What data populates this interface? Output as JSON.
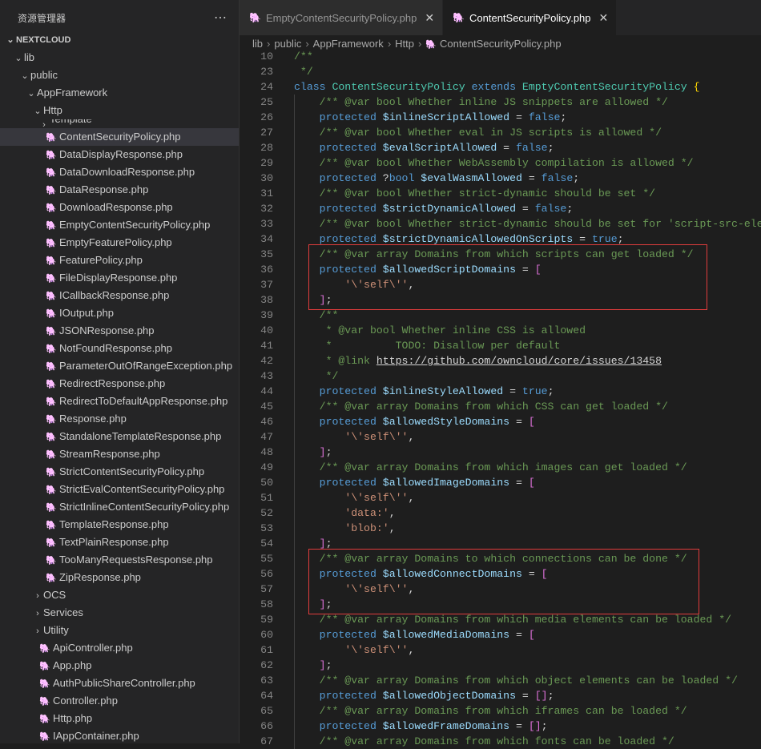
{
  "sidebar": {
    "title": "资源管理器",
    "more_icon": "ellipsis-icon",
    "root": "NEXTCLOUD",
    "tree": [
      {
        "label": "lib",
        "type": "folder",
        "open": true,
        "level": 1
      },
      {
        "label": "public",
        "type": "folder",
        "open": true,
        "level": 2
      },
      {
        "label": "AppFramework",
        "type": "folder",
        "open": true,
        "level": 3
      },
      {
        "label": "Http",
        "type": "folder",
        "open": true,
        "level": 4
      },
      {
        "label": "Template",
        "type": "folder",
        "open": false,
        "level": 5
      },
      {
        "label": "ContentSecurityPolicy.php",
        "type": "php",
        "level": 5,
        "selected": true
      },
      {
        "label": "DataDisplayResponse.php",
        "type": "php",
        "level": 5
      },
      {
        "label": "DataDownloadResponse.php",
        "type": "php",
        "level": 5
      },
      {
        "label": "DataResponse.php",
        "type": "php",
        "level": 5
      },
      {
        "label": "DownloadResponse.php",
        "type": "php",
        "level": 5
      },
      {
        "label": "EmptyContentSecurityPolicy.php",
        "type": "php",
        "level": 5
      },
      {
        "label": "EmptyFeaturePolicy.php",
        "type": "php",
        "level": 5
      },
      {
        "label": "FeaturePolicy.php",
        "type": "php",
        "level": 5
      },
      {
        "label": "FileDisplayResponse.php",
        "type": "php",
        "level": 5
      },
      {
        "label": "ICallbackResponse.php",
        "type": "php",
        "level": 5
      },
      {
        "label": "IOutput.php",
        "type": "php",
        "level": 5
      },
      {
        "label": "JSONResponse.php",
        "type": "php",
        "level": 5
      },
      {
        "label": "NotFoundResponse.php",
        "type": "php",
        "level": 5
      },
      {
        "label": "ParameterOutOfRangeException.php",
        "type": "php",
        "level": 5
      },
      {
        "label": "RedirectResponse.php",
        "type": "php",
        "level": 5
      },
      {
        "label": "RedirectToDefaultAppResponse.php",
        "type": "php",
        "level": 5
      },
      {
        "label": "Response.php",
        "type": "php",
        "level": 5
      },
      {
        "label": "StandaloneTemplateResponse.php",
        "type": "php",
        "level": 5
      },
      {
        "label": "StreamResponse.php",
        "type": "php",
        "level": 5
      },
      {
        "label": "StrictContentSecurityPolicy.php",
        "type": "php",
        "level": 5
      },
      {
        "label": "StrictEvalContentSecurityPolicy.php",
        "type": "php",
        "level": 5
      },
      {
        "label": "StrictInlineContentSecurityPolicy.php",
        "type": "php",
        "level": 5
      },
      {
        "label": "TemplateResponse.php",
        "type": "php",
        "level": 5
      },
      {
        "label": "TextPlainResponse.php",
        "type": "php",
        "level": 5
      },
      {
        "label": "TooManyRequestsResponse.php",
        "type": "php",
        "level": 5
      },
      {
        "label": "ZipResponse.php",
        "type": "php",
        "level": 5
      },
      {
        "label": "OCS",
        "type": "folder",
        "open": false,
        "level": 4
      },
      {
        "label": "Services",
        "type": "folder",
        "open": false,
        "level": 4
      },
      {
        "label": "Utility",
        "type": "folder",
        "open": false,
        "level": 4
      },
      {
        "label": "ApiController.php",
        "type": "php",
        "level": 4
      },
      {
        "label": "App.php",
        "type": "php",
        "level": 4
      },
      {
        "label": "AuthPublicShareController.php",
        "type": "php",
        "level": 4
      },
      {
        "label": "Controller.php",
        "type": "php",
        "level": 4
      },
      {
        "label": "Http.php",
        "type": "php",
        "level": 4
      },
      {
        "label": "IAppContainer.php",
        "type": "php",
        "level": 4
      }
    ]
  },
  "tabs": [
    {
      "label": "EmptyContentSecurityPolicy.php",
      "active": false,
      "icon": "php-elephant-icon"
    },
    {
      "label": "ContentSecurityPolicy.php",
      "active": true,
      "icon": "php-elephant-icon"
    }
  ],
  "breadcrumb": [
    "lib",
    "public",
    "AppFramework",
    "Http",
    "ContentSecurityPolicy.php"
  ],
  "colors": {
    "comment": "#6a9955",
    "keyword": "#569cd6",
    "variable": "#9cdcfe",
    "class": "#4ec9b0",
    "string": "#ce9178",
    "bracket": "#da70d6",
    "brace": "#ffd700",
    "highlight_box": "#e03c3c",
    "php_icon": "#a074c4"
  },
  "code": [
    {
      "n": "10",
      "t": [
        [
          "c",
          "/**"
        ]
      ]
    },
    {
      "n": "23",
      "t": [
        [
          "c",
          " */"
        ]
      ]
    },
    {
      "n": "24",
      "t": [
        [
          "k",
          "class "
        ],
        [
          "cl",
          "ContentSecurityPolicy "
        ],
        [
          "k",
          "extends "
        ],
        [
          "cl",
          "EmptyContentSecurityPolicy "
        ],
        [
          "b2",
          "{"
        ]
      ]
    },
    {
      "n": "25",
      "t": [
        [
          "p",
          "    "
        ],
        [
          "c",
          "/** @var bool Whether inline JS snippets are allowed */"
        ]
      ]
    },
    {
      "n": "26",
      "t": [
        [
          "p",
          "    "
        ],
        [
          "k",
          "protected "
        ],
        [
          "v",
          "$inlineScriptAllowed"
        ],
        [
          "p",
          " = "
        ],
        [
          "k",
          "false"
        ],
        [
          "p",
          ";"
        ]
      ]
    },
    {
      "n": "27",
      "t": [
        [
          "p",
          "    "
        ],
        [
          "c",
          "/** @var bool Whether eval in JS scripts is allowed */"
        ]
      ]
    },
    {
      "n": "28",
      "t": [
        [
          "p",
          "    "
        ],
        [
          "k",
          "protected "
        ],
        [
          "v",
          "$evalScriptAllowed"
        ],
        [
          "p",
          " = "
        ],
        [
          "k",
          "false"
        ],
        [
          "p",
          ";"
        ]
      ]
    },
    {
      "n": "29",
      "t": [
        [
          "p",
          "    "
        ],
        [
          "c",
          "/** @var bool Whether WebAssembly compilation is allowed */"
        ]
      ]
    },
    {
      "n": "30",
      "t": [
        [
          "p",
          "    "
        ],
        [
          "k",
          "protected "
        ],
        [
          "p",
          "?"
        ],
        [
          "k",
          "bool "
        ],
        [
          "v",
          "$evalWasmAllowed"
        ],
        [
          "p",
          " = "
        ],
        [
          "k",
          "false"
        ],
        [
          "p",
          ";"
        ]
      ]
    },
    {
      "n": "31",
      "t": [
        [
          "p",
          "    "
        ],
        [
          "c",
          "/** @var bool Whether strict-dynamic should be set */"
        ]
      ]
    },
    {
      "n": "32",
      "t": [
        [
          "p",
          "    "
        ],
        [
          "k",
          "protected "
        ],
        [
          "v",
          "$strictDynamicAllowed"
        ],
        [
          "p",
          " = "
        ],
        [
          "k",
          "false"
        ],
        [
          "p",
          ";"
        ]
      ]
    },
    {
      "n": "33",
      "t": [
        [
          "p",
          "    "
        ],
        [
          "c",
          "/** @var bool Whether strict-dynamic should be set for 'script-src-elem'"
        ]
      ]
    },
    {
      "n": "34",
      "t": [
        [
          "p",
          "    "
        ],
        [
          "k",
          "protected "
        ],
        [
          "v",
          "$strictDynamicAllowedOnScripts"
        ],
        [
          "p",
          " = "
        ],
        [
          "k",
          "true"
        ],
        [
          "p",
          ";"
        ]
      ]
    },
    {
      "n": "35",
      "t": [
        [
          "p",
          "    "
        ],
        [
          "c",
          "/** @var array Domains from which scripts can get loaded */"
        ]
      ]
    },
    {
      "n": "36",
      "t": [
        [
          "p",
          "    "
        ],
        [
          "k",
          "protected "
        ],
        [
          "v",
          "$allowedScriptDomains"
        ],
        [
          "p",
          " = "
        ],
        [
          "b",
          "["
        ]
      ]
    },
    {
      "n": "37",
      "t": [
        [
          "p",
          "        "
        ],
        [
          "s",
          "'\\'self\\''"
        ],
        [
          "p",
          ","
        ]
      ]
    },
    {
      "n": "38",
      "t": [
        [
          "p",
          "    "
        ],
        [
          "b",
          "]"
        ],
        [
          "p",
          ";"
        ]
      ]
    },
    {
      "n": "39",
      "t": [
        [
          "p",
          "    "
        ],
        [
          "c",
          "/**"
        ]
      ]
    },
    {
      "n": "40",
      "t": [
        [
          "p",
          "    "
        ],
        [
          "c",
          " * @var bool Whether inline CSS is allowed"
        ]
      ]
    },
    {
      "n": "41",
      "t": [
        [
          "p",
          "    "
        ],
        [
          "c",
          " *          TODO: Disallow per default"
        ]
      ]
    },
    {
      "n": "42",
      "t": [
        [
          "p",
          "    "
        ],
        [
          "c",
          " * @link "
        ],
        [
          "l",
          "https://github.com/owncloud/core/issues/13458"
        ]
      ]
    },
    {
      "n": "43",
      "t": [
        [
          "p",
          "    "
        ],
        [
          "c",
          " */"
        ]
      ]
    },
    {
      "n": "44",
      "t": [
        [
          "p",
          "    "
        ],
        [
          "k",
          "protected "
        ],
        [
          "v",
          "$inlineStyleAllowed"
        ],
        [
          "p",
          " = "
        ],
        [
          "k",
          "true"
        ],
        [
          "p",
          ";"
        ]
      ]
    },
    {
      "n": "45",
      "t": [
        [
          "p",
          "    "
        ],
        [
          "c",
          "/** @var array Domains from which CSS can get loaded */"
        ]
      ]
    },
    {
      "n": "46",
      "t": [
        [
          "p",
          "    "
        ],
        [
          "k",
          "protected "
        ],
        [
          "v",
          "$allowedStyleDomains"
        ],
        [
          "p",
          " = "
        ],
        [
          "b",
          "["
        ]
      ]
    },
    {
      "n": "47",
      "t": [
        [
          "p",
          "        "
        ],
        [
          "s",
          "'\\'self\\''"
        ],
        [
          "p",
          ","
        ]
      ]
    },
    {
      "n": "48",
      "t": [
        [
          "p",
          "    "
        ],
        [
          "b",
          "]"
        ],
        [
          "p",
          ";"
        ]
      ]
    },
    {
      "n": "49",
      "t": [
        [
          "p",
          "    "
        ],
        [
          "c",
          "/** @var array Domains from which images can get loaded */"
        ]
      ]
    },
    {
      "n": "50",
      "t": [
        [
          "p",
          "    "
        ],
        [
          "k",
          "protected "
        ],
        [
          "v",
          "$allowedImageDomains"
        ],
        [
          "p",
          " = "
        ],
        [
          "b",
          "["
        ]
      ]
    },
    {
      "n": "51",
      "t": [
        [
          "p",
          "        "
        ],
        [
          "s",
          "'\\'self\\''"
        ],
        [
          "p",
          ","
        ]
      ]
    },
    {
      "n": "52",
      "t": [
        [
          "p",
          "        "
        ],
        [
          "s",
          "'data:'"
        ],
        [
          "p",
          ","
        ]
      ]
    },
    {
      "n": "53",
      "t": [
        [
          "p",
          "        "
        ],
        [
          "s",
          "'blob:'"
        ],
        [
          "p",
          ","
        ]
      ]
    },
    {
      "n": "54",
      "t": [
        [
          "p",
          "    "
        ],
        [
          "b",
          "]"
        ],
        [
          "p",
          ";"
        ]
      ]
    },
    {
      "n": "55",
      "t": [
        [
          "p",
          "    "
        ],
        [
          "c",
          "/** @var array Domains to which connections can be done */"
        ]
      ]
    },
    {
      "n": "56",
      "t": [
        [
          "p",
          "    "
        ],
        [
          "k",
          "protected "
        ],
        [
          "v",
          "$allowedConnectDomains"
        ],
        [
          "p",
          " = "
        ],
        [
          "b",
          "["
        ]
      ]
    },
    {
      "n": "57",
      "t": [
        [
          "p",
          "        "
        ],
        [
          "s",
          "'\\'self\\''"
        ],
        [
          "p",
          ","
        ]
      ]
    },
    {
      "n": "58",
      "t": [
        [
          "p",
          "    "
        ],
        [
          "b",
          "]"
        ],
        [
          "p",
          ";"
        ]
      ]
    },
    {
      "n": "59",
      "t": [
        [
          "p",
          "    "
        ],
        [
          "c",
          "/** @var array Domains from which media elements can be loaded */"
        ]
      ]
    },
    {
      "n": "60",
      "t": [
        [
          "p",
          "    "
        ],
        [
          "k",
          "protected "
        ],
        [
          "v",
          "$allowedMediaDomains"
        ],
        [
          "p",
          " = "
        ],
        [
          "b",
          "["
        ]
      ]
    },
    {
      "n": "61",
      "t": [
        [
          "p",
          "        "
        ],
        [
          "s",
          "'\\'self\\''"
        ],
        [
          "p",
          ","
        ]
      ]
    },
    {
      "n": "62",
      "t": [
        [
          "p",
          "    "
        ],
        [
          "b",
          "]"
        ],
        [
          "p",
          ";"
        ]
      ]
    },
    {
      "n": "63",
      "t": [
        [
          "p",
          "    "
        ],
        [
          "c",
          "/** @var array Domains from which object elements can be loaded */"
        ]
      ]
    },
    {
      "n": "64",
      "t": [
        [
          "p",
          "    "
        ],
        [
          "k",
          "protected "
        ],
        [
          "v",
          "$allowedObjectDomains"
        ],
        [
          "p",
          " = "
        ],
        [
          "b",
          "[]"
        ],
        [
          "p",
          ";"
        ]
      ]
    },
    {
      "n": "65",
      "t": [
        [
          "p",
          "    "
        ],
        [
          "c",
          "/** @var array Domains from which iframes can be loaded */"
        ]
      ]
    },
    {
      "n": "66",
      "t": [
        [
          "p",
          "    "
        ],
        [
          "k",
          "protected "
        ],
        [
          "v",
          "$allowedFrameDomains"
        ],
        [
          "p",
          " = "
        ],
        [
          "b",
          "[]"
        ],
        [
          "p",
          ";"
        ]
      ]
    },
    {
      "n": "67",
      "t": [
        [
          "p",
          "    "
        ],
        [
          "c",
          "/** @var array Domains from which fonts can be loaded */"
        ]
      ]
    }
  ],
  "highlights": [
    {
      "from_line": "35",
      "to_line": "38"
    },
    {
      "from_line": "55",
      "to_line": "58"
    }
  ]
}
